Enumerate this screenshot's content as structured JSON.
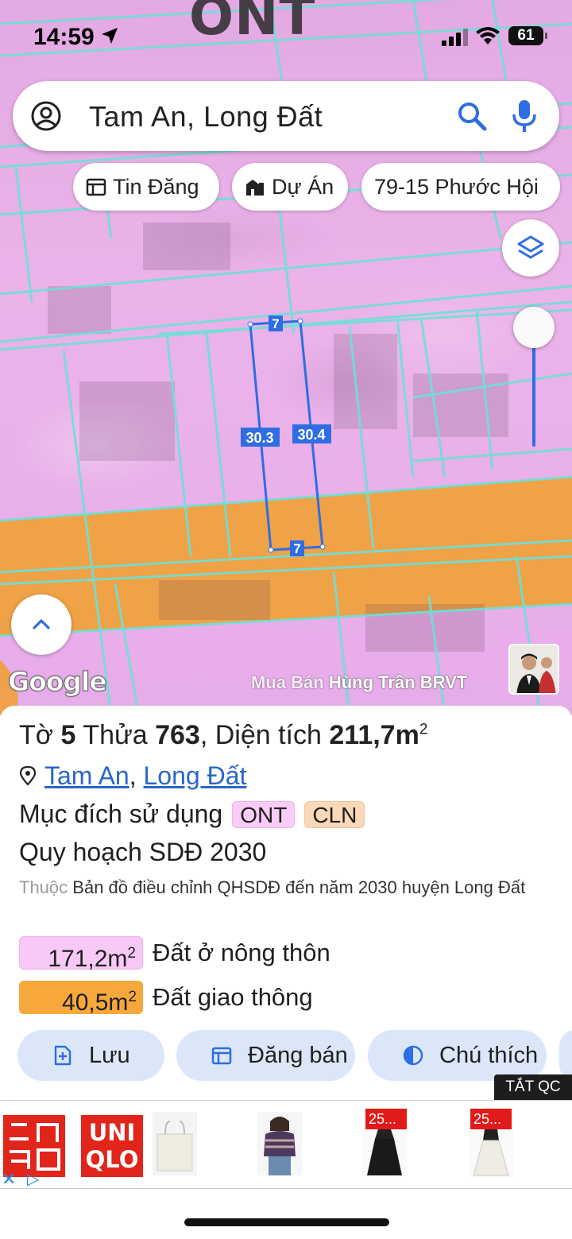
{
  "status_bar": {
    "time": "14:59",
    "battery": "61"
  },
  "map": {
    "zone_label": "ONT",
    "parcel_edges": {
      "top": "7",
      "left": "30.3",
      "right": "30.4",
      "bottom": "7"
    },
    "google": "Google",
    "watermark_prefix": "Mua Bán",
    "watermark_name": "Hùng Trần BRVT"
  },
  "search": {
    "query": "Tam An, Long Đất"
  },
  "chips": [
    {
      "label": "Tin Đăng",
      "icon": "calendar-icon"
    },
    {
      "label": "Dự Án",
      "icon": "buildings-icon"
    },
    {
      "label": "79-15 Phước Hội"
    }
  ],
  "parcel": {
    "to_label": "Tờ",
    "to_num": "5",
    "thua_label": "Thửa",
    "thua_num": "763",
    "area_label": ", Diện tích",
    "area_value": "211,7m",
    "area_sup": "2",
    "location_1": "Tam An",
    "location_sep": ",",
    "location_2": "Long Đất",
    "purpose_label": "Mục đích sử dụng",
    "purpose_badges": [
      "ONT",
      "CLN"
    ],
    "plan_title": "Quy hoạch SDĐ 2030",
    "plan_prefix": "Thuộc",
    "plan_desc": "Bản đồ điều chỉnh QHSDĐ đến năm 2030 huyện Long Đất",
    "areas": [
      {
        "value": "171,2m",
        "sup": "2",
        "label": "Đất ở nông thôn",
        "color": "#f8c8f6"
      },
      {
        "value": "40,5m",
        "sup": "2",
        "label": "Đất giao thông",
        "color": "#f7a83b"
      }
    ]
  },
  "actions": [
    {
      "label": "Lưu",
      "icon": "add-doc-icon"
    },
    {
      "label": "Đăng bán",
      "icon": "calendar-icon"
    },
    {
      "label": "Chú thích",
      "icon": "contrast-icon"
    }
  ],
  "ad": {
    "close_label": "TẮT QC",
    "brand_line1": "UNI",
    "brand_line2": "QLO",
    "price_tags": [
      "25...",
      "25..."
    ]
  },
  "colors": {
    "accent": "#2f6de2",
    "ont": "#e9aee8",
    "road": "#f0a13a"
  }
}
